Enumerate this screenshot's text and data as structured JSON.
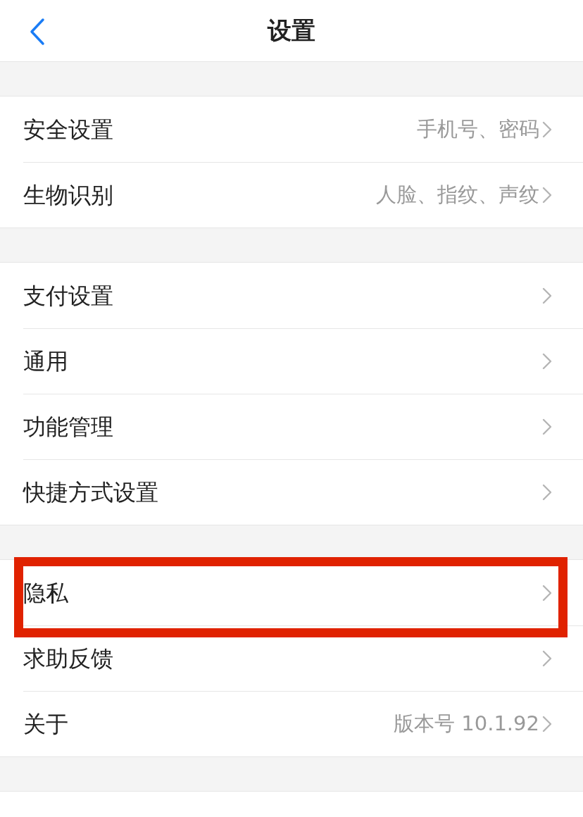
{
  "header": {
    "title": "设置"
  },
  "sections": [
    {
      "items": [
        {
          "label": "安全设置",
          "value": "手机号、密码",
          "highlighted": false
        },
        {
          "label": "生物识别",
          "value": "人脸、指纹、声纹",
          "highlighted": false
        }
      ]
    },
    {
      "items": [
        {
          "label": "支付设置",
          "highlighted": false
        },
        {
          "label": "通用",
          "highlighted": false
        },
        {
          "label": "功能管理",
          "highlighted": false
        },
        {
          "label": "快捷方式设置",
          "highlighted": false
        }
      ]
    },
    {
      "items": [
        {
          "label": "隐私",
          "highlighted": true
        },
        {
          "label": "求助反馈",
          "highlighted": false
        },
        {
          "label": "关于",
          "value": "版本号 10.1.92",
          "highlighted": false
        }
      ]
    }
  ]
}
